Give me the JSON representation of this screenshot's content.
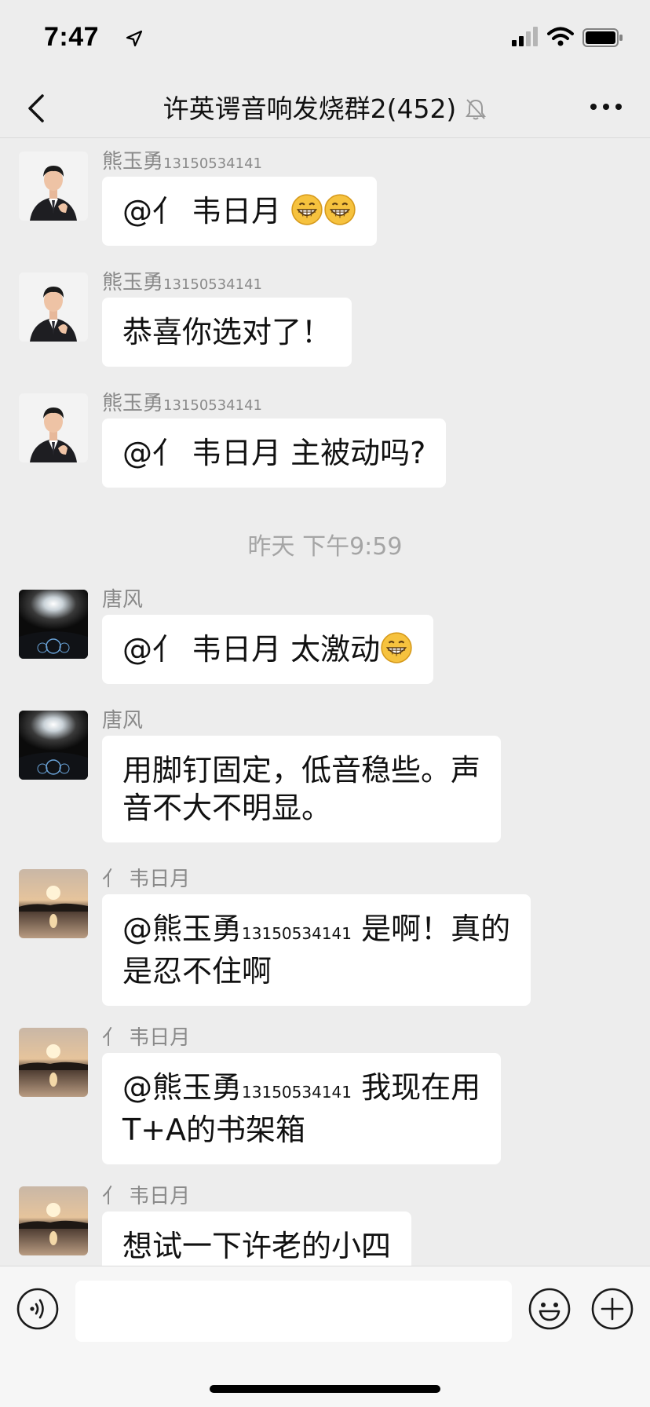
{
  "status_bar": {
    "time": "7:47",
    "icons": [
      "location-arrow-icon",
      "cellular-signal-icon",
      "wifi-icon",
      "battery-icon"
    ]
  },
  "nav": {
    "title": "许英谔音响发烧群2(452)",
    "icons": [
      "back-chevron-icon",
      "mute-bell-icon",
      "more-dots-icon"
    ]
  },
  "messages": [
    {
      "sender": "熊玉勇",
      "sender_sub": "13150534141",
      "text": "@亻 韦日月 ",
      "emoji_count": 2,
      "avatar": "man-in-suit-thumbs-up"
    },
    {
      "sender": "熊玉勇",
      "sender_sub": "13150534141",
      "text": "恭喜你选对了！",
      "avatar": "man-in-suit-thumbs-up"
    },
    {
      "sender": "熊玉勇",
      "sender_sub": "13150534141",
      "text": "@亻 韦日月 主被动吗?",
      "avatar": "man-in-suit-thumbs-up"
    },
    {
      "timestamp": "昨天 下午9:59"
    },
    {
      "sender": "唐风",
      "text": "@亻 韦日月 太激动",
      "emoji_count": 1,
      "avatar": "car-headlights-night"
    },
    {
      "sender": "唐风",
      "text_line1": "用脚钉固定，低音稳些。声",
      "text_line2": "音不大不明显。",
      "avatar": "car-headlights-night"
    },
    {
      "sender": "亻 韦日月",
      "mention": "@熊玉勇",
      "mention_sub": "13150534141",
      "text_line1_rest": " 是啊！真的",
      "text_line2": "是忍不住啊",
      "avatar": "sunset-over-water"
    },
    {
      "sender": "亻 韦日月",
      "mention": "@熊玉勇",
      "mention_sub": "13150534141",
      "text_line1_rest": " 我现在用",
      "text_line2": "T+A的书架箱",
      "avatar": "sunset-over-water"
    },
    {
      "sender": "亻 韦日月",
      "text": "想试一下许老的小四",
      "avatar": "sunset-over-water"
    }
  ],
  "input_bar": {
    "value": "",
    "icons": [
      "voice-icon",
      "emoji-face-icon",
      "plus-circle-icon"
    ]
  },
  "colors": {
    "background": "#ededed",
    "bubble": "#ffffff",
    "sender_text": "#8a8a8a",
    "timestamp_text": "#a5a5a5",
    "emoji_yellow": "#f6c23e"
  }
}
